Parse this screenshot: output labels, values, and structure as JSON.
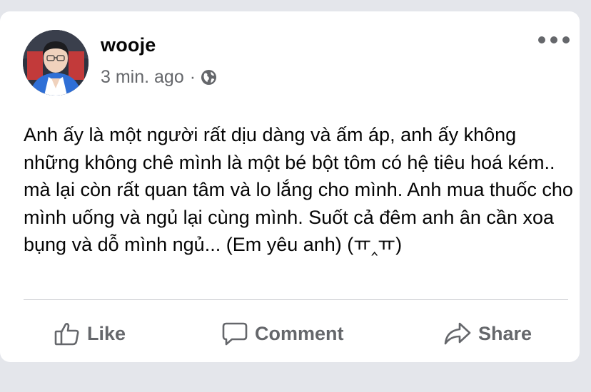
{
  "post": {
    "author": "wooje",
    "timestamp": "3 min. ago",
    "separator": "·",
    "privacy_icon": "globe-icon",
    "text": "Anh ấy là một người rất dịu dàng và ấm áp, anh ấy không những không chê mình là một bé bột tôm có hệ tiêu hoá kém.. mà lại còn rất quan tâm và lo lắng cho mình. Anh mua thuốc cho mình uống và ngủ lại cùng mình. Suốt cả đêm anh ân cần xoa bụng và dỗ mình ngủ... (Em yêu anh) (ㅠ‸ㅠ)"
  },
  "actions": {
    "like_label": "Like",
    "comment_label": "Comment",
    "share_label": "Share"
  },
  "icons": {
    "more": "more-options-icon",
    "like": "thumbs-up-icon",
    "comment": "comment-bubble-icon",
    "share": "share-arrow-icon"
  },
  "colors": {
    "background": "#e4e6eb",
    "card": "#ffffff",
    "primary_text": "#050505",
    "secondary_text": "#65676b",
    "divider": "#ced0d4"
  }
}
